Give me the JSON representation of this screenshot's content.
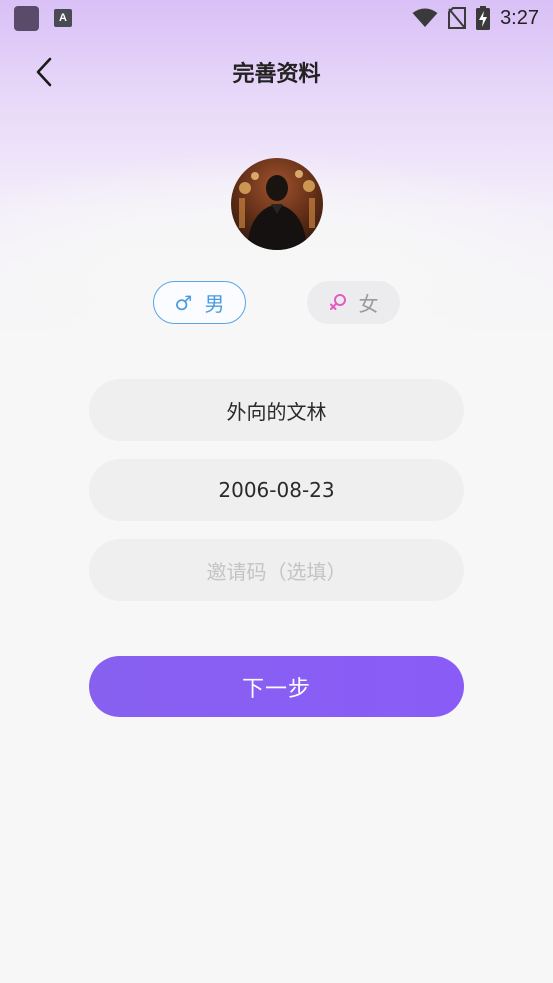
{
  "status_bar": {
    "time": "3:27",
    "app_icon": "app-icon",
    "notification_icon": "a-icon",
    "wifi_icon": "wifi-icon",
    "sim_icon": "no-sim-icon",
    "battery_icon": "battery-charging-icon"
  },
  "header": {
    "title": "完善资料",
    "back_icon": "back-arrow-icon"
  },
  "profile": {
    "avatar_icon": "avatar"
  },
  "gender": {
    "male_label": "男",
    "male_symbol": "♂",
    "female_label": "女",
    "female_symbol": "♀",
    "selected": "male"
  },
  "form": {
    "nickname_value": "外向的文林",
    "birthday_value": "2006-08-23",
    "invite_placeholder": "邀请码（选填）"
  },
  "actions": {
    "next_label": "下一步"
  },
  "colors": {
    "accent": "#8a5cf7",
    "male": "#4a9be0",
    "female": "#e25cc2"
  }
}
